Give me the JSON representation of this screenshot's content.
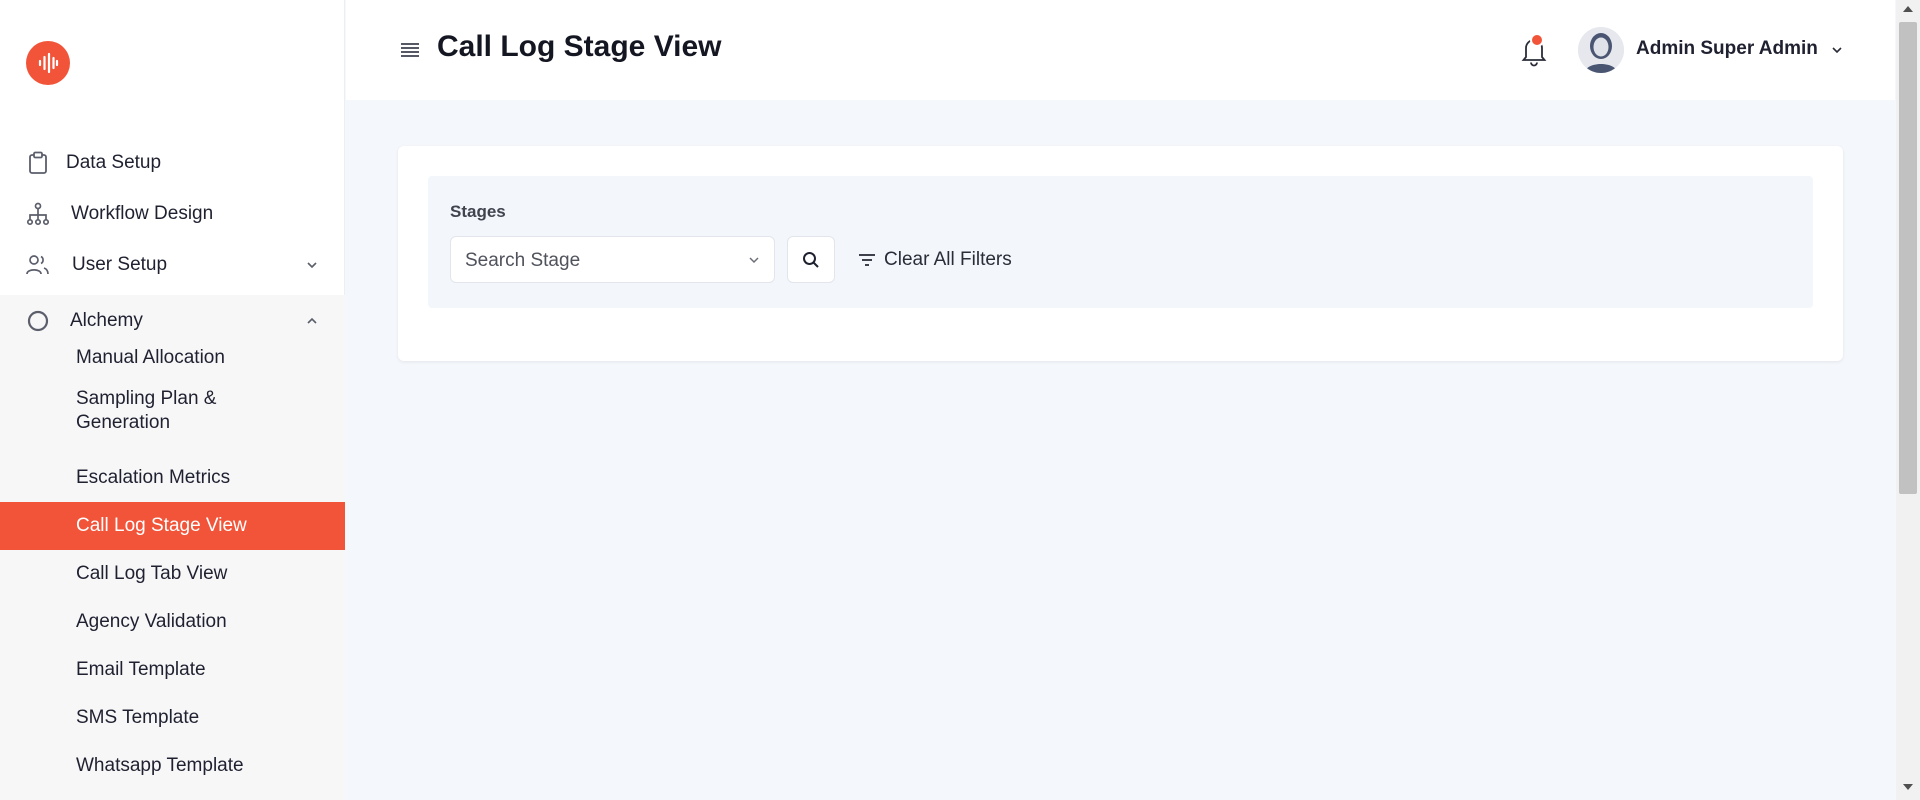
{
  "sidebar": {
    "logo_icon": "soundwave-icon",
    "items": [
      {
        "label": "Data Setup",
        "icon": "clipboard-icon"
      },
      {
        "label": "Workflow Design",
        "icon": "hierarchy-icon"
      },
      {
        "label": "User Setup",
        "icon": "users-icon",
        "expanded": false
      },
      {
        "label": "Alchemy",
        "icon": "circle-icon",
        "expanded": true
      }
    ],
    "sub_items": [
      {
        "label": "Manual Allocation"
      },
      {
        "label": "Sampling Plan & Generation"
      },
      {
        "label": "Escalation Metrics"
      },
      {
        "label": "Call Log Stage View",
        "active": true
      },
      {
        "label": "Call Log Tab View"
      },
      {
        "label": "Agency Validation"
      },
      {
        "label": "Email Template"
      },
      {
        "label": "SMS Template"
      },
      {
        "label": "Whatsapp Template"
      }
    ]
  },
  "header": {
    "title": "Call Log Stage View",
    "user_name": "Admin Super Admin",
    "has_notification": true
  },
  "filters": {
    "stages_label": "Stages",
    "stage_placeholder": "Search Stage",
    "clear_label": "Clear All Filters"
  },
  "colors": {
    "accent": "#f25439",
    "background": "#f4f7fb",
    "sidebar_sub_bg": "#f7f7f8"
  }
}
